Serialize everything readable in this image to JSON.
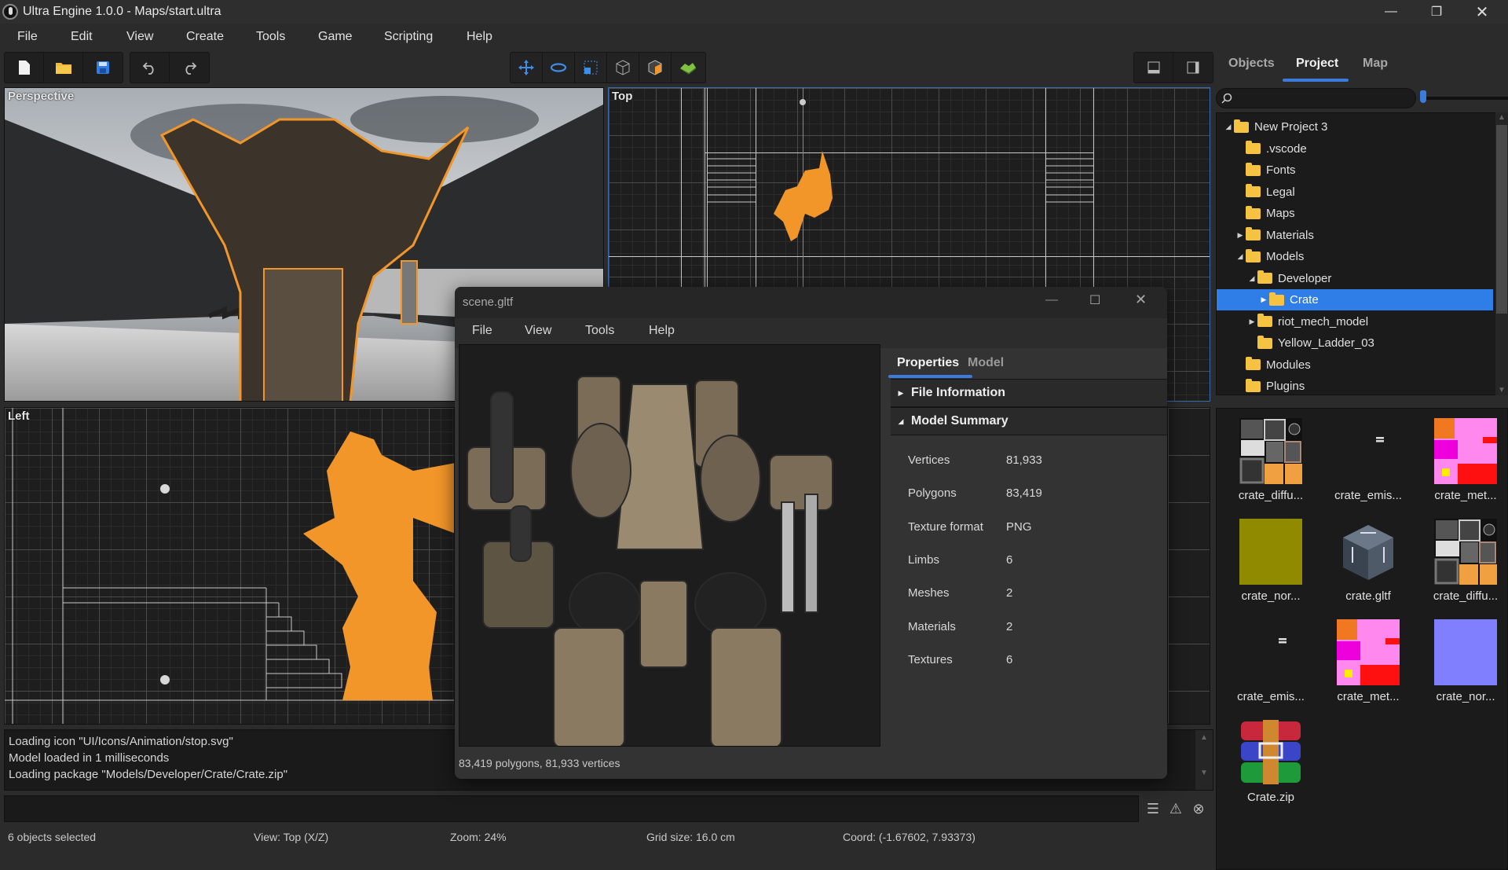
{
  "window": {
    "title": "Ultra Engine 1.0.0 - Maps/start.ultra"
  },
  "menu": [
    "File",
    "Edit",
    "View",
    "Create",
    "Tools",
    "Game",
    "Scripting",
    "Help"
  ],
  "toolbar": {
    "file_group": [
      "new-file-icon",
      "open-folder-icon",
      "save-icon"
    ],
    "history_group": [
      "undo-icon",
      "redo-icon"
    ],
    "tool_group": [
      "move-icon",
      "rotate-icon",
      "scale-icon",
      "wireframe-cube-icon",
      "solid-cube-icon",
      "terrain-icon"
    ],
    "layout_group": [
      "bottom-panel-icon",
      "side-panel-icon"
    ]
  },
  "viewports": {
    "perspective": "Perspective",
    "top": "Top",
    "left": "Left"
  },
  "log": {
    "lines": [
      "Loading icon \"UI/Icons/Animation/stop.svg\"",
      "Model loaded in 1 milliseconds",
      "Loading package \"Models/Developer/Crate/Crate.zip\""
    ]
  },
  "status": {
    "selection": "6 objects selected",
    "view": "View: Top (X/Z)",
    "zoom": "Zoom: 24%",
    "grid": "Grid size: 16.0 cm",
    "coord": "Coord: (-1.67602, 7.93373)"
  },
  "right_panel": {
    "tabs": [
      {
        "label": "Objects",
        "active": false
      },
      {
        "label": "Project",
        "active": true
      },
      {
        "label": "Map",
        "active": false
      }
    ],
    "search": {
      "placeholder": "",
      "value": ""
    },
    "tree": [
      {
        "label": "New Project 3",
        "depth": 0,
        "expander": "open"
      },
      {
        "label": ".vscode",
        "depth": 1,
        "expander": "none"
      },
      {
        "label": "Fonts",
        "depth": 1,
        "expander": "none"
      },
      {
        "label": "Legal",
        "depth": 1,
        "expander": "none"
      },
      {
        "label": "Maps",
        "depth": 1,
        "expander": "none"
      },
      {
        "label": "Materials",
        "depth": 1,
        "expander": "closed"
      },
      {
        "label": "Models",
        "depth": 1,
        "expander": "open"
      },
      {
        "label": "Developer",
        "depth": 2,
        "expander": "open"
      },
      {
        "label": "Crate",
        "depth": 3,
        "expander": "closed",
        "selected": true
      },
      {
        "label": "riot_mech_model",
        "depth": 2,
        "expander": "closed"
      },
      {
        "label": "Yellow_Ladder_03",
        "depth": 2,
        "expander": "none"
      },
      {
        "label": "Modules",
        "depth": 1,
        "expander": "none"
      },
      {
        "label": "Plugins",
        "depth": 1,
        "expander": "none"
      }
    ],
    "assets": [
      {
        "name": "crate_diffu...",
        "kind": "diffuse-texture"
      },
      {
        "name": "crate_emis...",
        "kind": "emission-texture"
      },
      {
        "name": "crate_met...",
        "kind": "metal-texture"
      },
      {
        "name": "crate_nor...",
        "kind": "olive-texture"
      },
      {
        "name": "crate.gltf",
        "kind": "model"
      },
      {
        "name": "crate_diffu...",
        "kind": "diffuse-texture"
      },
      {
        "name": "crate_emis...",
        "kind": "emission-texture"
      },
      {
        "name": "crate_met...",
        "kind": "metal-texture"
      },
      {
        "name": "crate_nor...",
        "kind": "normal-texture"
      },
      {
        "name": "Crate.zip",
        "kind": "archive"
      }
    ]
  },
  "model_window": {
    "title": "scene.gltf",
    "menu": [
      "File",
      "View",
      "Tools",
      "Help"
    ],
    "tabs": [
      {
        "label": "Properties",
        "active": true
      },
      {
        "label": "Model",
        "active": false
      }
    ],
    "sections": [
      {
        "label": "File Information",
        "expanded": false
      },
      {
        "label": "Model Summary",
        "expanded": true
      }
    ],
    "summary": [
      {
        "label": "Vertices",
        "value": "81,933"
      },
      {
        "label": "Polygons",
        "value": "83,419"
      },
      {
        "label": "Texture format",
        "value": "PNG"
      },
      {
        "label": "Limbs",
        "value": "6"
      },
      {
        "label": "Meshes",
        "value": "2"
      },
      {
        "label": "Materials",
        "value": "2"
      },
      {
        "label": "Textures",
        "value": "6"
      }
    ],
    "status": "83,419 polygons, 81,933 vertices"
  },
  "colors": {
    "accent": "#3a7bdc",
    "selection": "#2f7ee8",
    "highlight_orange": "#f2962a",
    "folder": "#f5c242"
  }
}
